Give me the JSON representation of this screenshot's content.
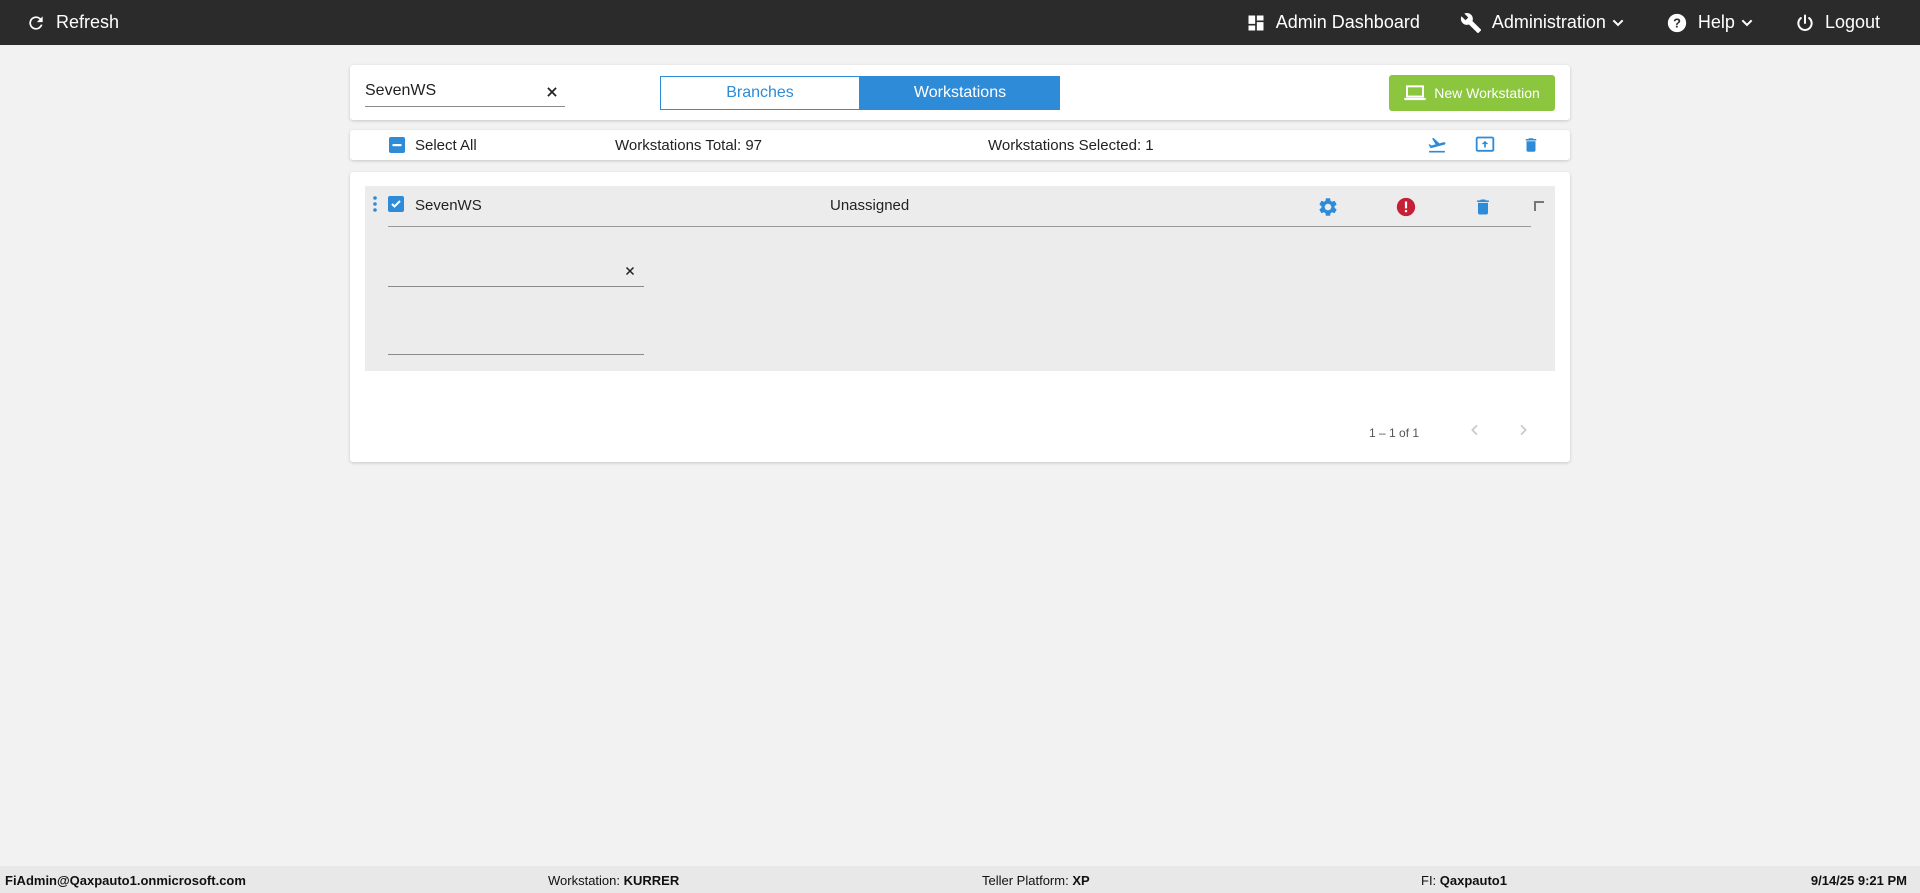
{
  "topbar": {
    "refresh_label": "Refresh",
    "admin_dashboard_label": "Admin Dashboard",
    "administration_label": "Administration",
    "help_label": "Help",
    "logout_label": "Logout"
  },
  "filter": {
    "search_value": "SevenWS",
    "tabs": [
      {
        "label": "Branches",
        "active": false
      },
      {
        "label": "Workstations",
        "active": true
      }
    ],
    "new_button_label": "New Workstation"
  },
  "summary": {
    "select_all_label": "Select All",
    "total_text": "Workstations Total: 97",
    "selected_text": "Workstations Selected: 1"
  },
  "workstations": [
    {
      "name": "SevenWS",
      "branch": "Unassigned",
      "checked": true
    }
  ],
  "pager": {
    "range_text": "1 – 1 of 1"
  },
  "statusbar": {
    "user": "FiAdmin@Qaxpauto1.onmicrosoft.com",
    "workstation_label": "Workstation: ",
    "workstation_value": "KURRER",
    "platform_label": "Teller Platform: ",
    "platform_value": "XP",
    "fi_label": "FI: ",
    "fi_value": "Qaxpauto1",
    "datetime": "9/14/25 9:21 PM"
  },
  "colors": {
    "topbar": "#2b2b2b",
    "accent_blue": "#2e8bd8",
    "new_button_green": "#8cc63f",
    "error_red": "#c62036",
    "background": "#f2f2f2"
  },
  "icons": {
    "refresh": "refresh-icon",
    "dashboard": "dashboard-icon",
    "wrench": "wrench-icon",
    "help": "help-icon",
    "power": "power-icon",
    "laptop": "laptop-icon",
    "flight": "flight-takeoff-icon",
    "upload": "upload-icon",
    "trash": "trash-icon",
    "gear": "gear-icon",
    "info": "info-icon",
    "kebab": "more-vertical-icon"
  }
}
